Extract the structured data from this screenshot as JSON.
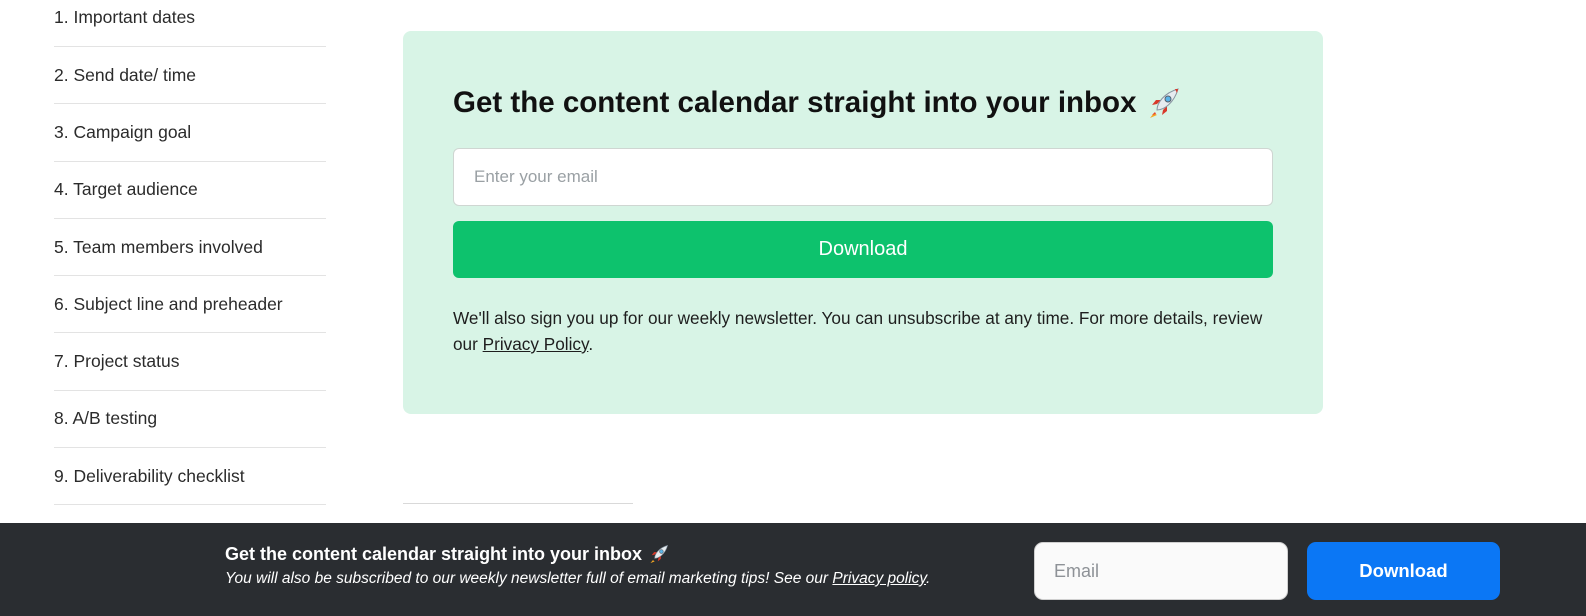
{
  "toc": {
    "items": [
      {
        "label": "1. Important dates"
      },
      {
        "label": "2. Send date/ time"
      },
      {
        "label": "3. Campaign goal"
      },
      {
        "label": "4. Target audience"
      },
      {
        "label": "5. Team members involved"
      },
      {
        "label": "6. Subject line and preheader"
      },
      {
        "label": "7. Project status"
      },
      {
        "label": "8. A/B testing"
      },
      {
        "label": "9. Deliverability checklist"
      }
    ]
  },
  "cta": {
    "title": "Get the content calendar straight into your inbox",
    "title_icon": "rocket-icon",
    "email_placeholder": "Enter your email",
    "email_value": "",
    "button_label": "Download",
    "note_text": "We'll also sign you up for our weekly newsletter. You can unsubscribe at any time. For more details, review our ",
    "note_link": "Privacy Policy",
    "note_end": ".",
    "background_color": "#d8f4e6",
    "button_color": "#0dc26d"
  },
  "sticky_bar": {
    "title": "Get the content calendar straight into your inbox",
    "title_icon": "rocket-icon",
    "subtitle_text": "You will also be subscribed to our weekly newsletter full of email marketing tips! See our ",
    "subtitle_link": "Privacy policy",
    "subtitle_end": ".",
    "email_placeholder": "Email",
    "email_value": "",
    "button_label": "Download",
    "background_color": "#2a2d31",
    "button_color": "#0b77f5"
  }
}
